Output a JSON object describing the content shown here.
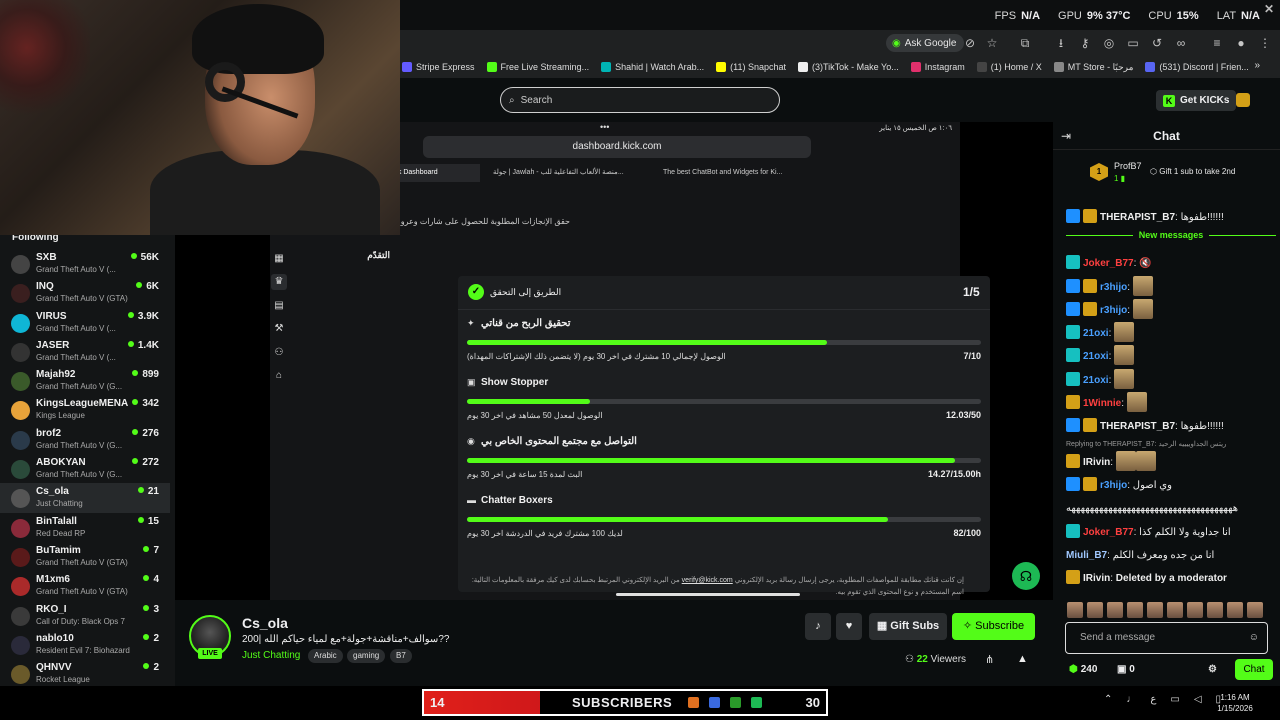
{
  "system_stats": {
    "fps_label": "FPS",
    "fps_value": "N/A",
    "gpu_label": "GPU",
    "gpu_value": "9% 37°C",
    "cpu_label": "CPU",
    "cpu_value": "15%",
    "lat_label": "LAT",
    "lat_value": "N/A"
  },
  "browser": {
    "ask_google": "Ask Google",
    "bookmarks": [
      {
        "label": "Stripe Express",
        "color": "#635bff"
      },
      {
        "label": "Free Live Streaming...",
        "color": "#53fc18"
      },
      {
        "label": "Shahid | Watch Arab...",
        "color": "#00b4b4"
      },
      {
        "label": "(11) Snapchat",
        "color": "#fffc00"
      },
      {
        "label": "(3)TikTok - Make Yo...",
        "color": "#111111"
      },
      {
        "label": "Instagram",
        "color": "#e1306c"
      },
      {
        "label": "(1) Home / X",
        "color": "#000000"
      },
      {
        "label": "MT Store - مرحبًا",
        "color": "#888888"
      },
      {
        "label": "(531) Discord | Frien...",
        "color": "#5865f2"
      }
    ]
  },
  "kick": {
    "search_placeholder": "Search",
    "get_kicks": "Get KICKs"
  },
  "following": {
    "heading": "Following",
    "channels": [
      {
        "name": "SXB",
        "game": "Grand Theft Auto V (...",
        "viewers": "56K",
        "color": "#444"
      },
      {
        "name": "INQ",
        "game": "Grand Theft Auto V (GTA)",
        "viewers": "6K",
        "color": "#2a1a1a"
      },
      {
        "name": "VIRUS",
        "game": "Grand Theft Auto V (...",
        "viewers": "3.9K",
        "color": "#0fb6d6"
      },
      {
        "name": "JASER",
        "game": "Grand Theft Auto V (...",
        "viewers": "1.4K",
        "color": "#333"
      },
      {
        "name": "Majah92",
        "game": "Grand Theft Auto V (G...",
        "viewers": "899",
        "color": "#3a5a2a"
      },
      {
        "name": "KingsLeagueMENA",
        "game": "Kings League",
        "viewers": "342",
        "color": "#e8a33a"
      },
      {
        "name": "brof2",
        "game": "Grand Theft Auto V (G...",
        "viewers": "276",
        "color": "#2a3a4a"
      },
      {
        "name": "ABOKYAN",
        "game": "Grand Theft Auto V (G...",
        "viewers": "272",
        "color": "#2a4a3a"
      },
      {
        "name": "Cs_ola",
        "game": "Just Chatting",
        "viewers": "21",
        "color": "#555"
      },
      {
        "name": "BinTalall",
        "game": "Red Dead RP",
        "viewers": "15",
        "color": "#8a2a3a"
      },
      {
        "name": "BuTamim",
        "game": "Grand Theft Auto V (GTA)",
        "viewers": "7",
        "color": "#5a1a1a"
      },
      {
        "name": "M1xm6",
        "game": "Grand Theft Auto V (GTA)",
        "viewers": "4",
        "color": "#aa2a2a"
      },
      {
        "name": "RKO_I",
        "game": "Call of Duty: Black Ops 7",
        "viewers": "3",
        "color": "#3a3a3a"
      },
      {
        "name": "nablo10",
        "game": "Resident Evil 7: Biohazard",
        "viewers": "2",
        "color": "#2a2a3a"
      },
      {
        "name": "QHNVV",
        "game": "Rocket League",
        "viewers": "2",
        "color": "#6a5a2a"
      }
    ]
  },
  "ipad": {
    "status_time": "١:٠٦ ص  الخميس ١٥ يناير",
    "url": "dashboard.kick.com",
    "tabs": [
      {
        "label": "Achievements - Kick Dashboard"
      },
      {
        "label": "جولة | Jawlah - منصة الألعاب التفاعلية للب..."
      },
      {
        "label": "The best ChatBot and Widgets for Ki..."
      }
    ]
  },
  "dashboard": {
    "subtitle": "حقق الإنجازات المطلوبة للحصول على شارات وعرو",
    "progress_heading": "التقدّم",
    "card_title": "الطريق إلى التحقق",
    "card_level": "1/5",
    "achievements": [
      {
        "name": "تحقيق الربح من قناتي",
        "desc": "الوصول لإجمالي 10 مشترك في اخر 30 يوم (لا يتضمن ذلك الإشتراكات المهداة)",
        "value": "7/10",
        "progress": 0.7
      },
      {
        "name": "Show Stopper",
        "desc": "الوصول لمعدل 50 مشاهد في اخر 30 يوم",
        "value": "12.03/50",
        "progress": 0.24
      },
      {
        "name": "التواصل مع مجتمع المحتوى الخاص بي",
        "desc": "البث لمدة 15 ساعة في اخر 30 يوم",
        "value": "14.27/15.00h",
        "progress": 0.95
      },
      {
        "name": "Chatter Boxers",
        "desc": "لديك 100 مشترك فريد في الدردشة اخر 30 يوم",
        "value": "82/100",
        "progress": 0.82
      }
    ],
    "footer_note": "إن كانت قناتك مطابقة للمواصفات المطلوبة، يرجى إرسال رسالة بريد الإلكتروني",
    "footer_link": "verify@kick.com",
    "footer_note2": "من البريد الإلكتروني المرتبط بحسابك لدى كيك مرفقة بالمعلومات التالية: اسم المستخدم و نوع المحتوى الذي تقوم بيه."
  },
  "chat": {
    "title": "Chat",
    "pinned_user": "ProfB7",
    "pinned_count": "1",
    "pinned_text": "Gift 1 sub to take 2nd",
    "new_messages": "New messages",
    "messages": [
      {
        "user": "THERAPIST_B7",
        "color": "#f0f0f0",
        "text": "طفوها!!!!!!",
        "badges": [
          "#1e90ff",
          "#d4a017"
        ]
      },
      {
        "user": "Joker_B77",
        "color": "#ff4040",
        "text": "",
        "badges": [
          "#16c0c0"
        ],
        "emotes": 1
      },
      {
        "user": "r3hijo",
        "color": "#4aa0ff",
        "text": "",
        "badges": [
          "#1e90ff",
          "#d4a017"
        ],
        "emotes": 1
      },
      {
        "user": "r3hijo",
        "color": "#4aa0ff",
        "text": "",
        "badges": [
          "#1e90ff",
          "#d4a017"
        ],
        "emotes": 1
      },
      {
        "user": "21oxi",
        "color": "#4aa0ff",
        "text": "",
        "badges": [
          "#16c0c0"
        ],
        "emotes": 1
      },
      {
        "user": "21oxi",
        "color": "#4aa0ff",
        "text": "",
        "badges": [
          "#16c0c0"
        ],
        "emotes": 1
      },
      {
        "user": "21oxi",
        "color": "#4aa0ff",
        "text": "",
        "badges": [
          "#16c0c0"
        ],
        "emotes": 1
      },
      {
        "user": "1Winnie",
        "color": "#ff4040",
        "text": "",
        "badges": [
          "#d4a017"
        ],
        "emotes": 1
      },
      {
        "user": "THERAPIST_B7",
        "color": "#f0f0f0",
        "text": "طفوها!!!!!!",
        "badges": [
          "#1e90ff",
          "#d4a017"
        ]
      }
    ],
    "reply_note": "Replying to THERAPIST_B7: ريتس الجداوييييه الرحيد",
    "messages2": [
      {
        "user": "IRivin",
        "color": "#f0f0f0",
        "text": "",
        "badges": [
          "#d4a017"
        ],
        "emotes": 2
      },
      {
        "user": "r3hijo",
        "color": "#4aa0ff",
        "text": "وي اصول",
        "badges": [
          "#1e90ff",
          "#d4a017"
        ]
      },
      {
        "user": "",
        "color": "#f0f0f0",
        "text": "ههههههههههههههههههههههههههههههههههههه",
        "badges": []
      },
      {
        "user": "Joker_B77",
        "color": "#ff4040",
        "text": "انا جداوية ولا الكلم كذا",
        "badges": [
          "#16c0c0"
        ]
      },
      {
        "user": "Miuli_B7",
        "color": "#a0c8ff",
        "text": "انا من جده ومعرف الكلم",
        "badges": []
      },
      {
        "user": "IRivin",
        "color": "#f0f0f0",
        "text": "Deleted by a moderator",
        "badges": [
          "#d4a017"
        ]
      }
    ],
    "send_placeholder": "Send a message",
    "points": "240",
    "count": "0",
    "chat_button": "Chat"
  },
  "stream": {
    "username": "Cs_ola",
    "live": "LIVE",
    "title": "200| سوالف+مناقشة+جولة+مع لمياء حياكم الله??",
    "category": "Just Chatting",
    "tags": [
      "Arabic",
      "gaming",
      "B7"
    ],
    "gift_subs": "Gift Subs",
    "subscribe": "Subscribe",
    "viewers_count": "22",
    "viewers_label": "Viewers"
  },
  "subbar": {
    "current": "14",
    "label": "SUBSCRIBERS",
    "goal": "30"
  },
  "clock": {
    "time": "1:16 AM",
    "date": "1/15/2026"
  }
}
